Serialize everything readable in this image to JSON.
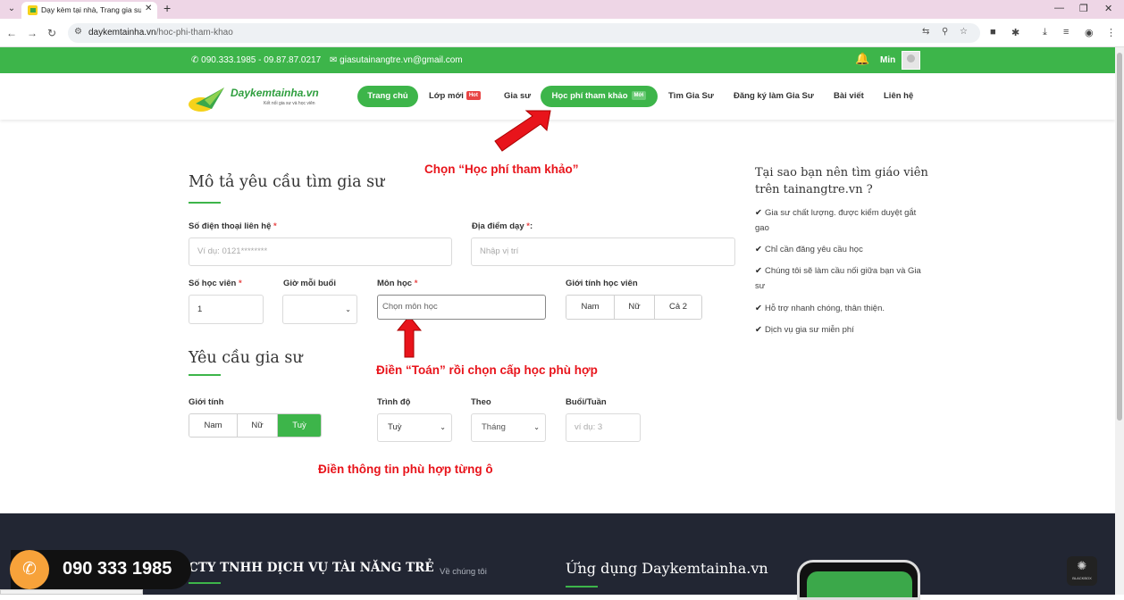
{
  "browser": {
    "tab_title": "Dạy kèm tại nhà, Trang gia sư tài năng trẻ",
    "url_domain": "daykemtainha.vn",
    "url_path": "/hoc-phi-tham-khao"
  },
  "topbar": {
    "phone": "090.333.1985 - 09.87.87.0217",
    "email": "giasutainangtre.vn@gmail.com",
    "user": "Min"
  },
  "logo": {
    "name": "Daykemtainha.vn",
    "tagline": "Kết nối gia sư và học viên"
  },
  "nav": {
    "home": "Trang chủ",
    "new_classes": "Lớp mới",
    "hot_badge": "Hot",
    "tutors": "Gia sư",
    "tuition": "Học phí tham khảo",
    "new_badge": "Mới",
    "find_tutor": "Tìm Gia Sư",
    "register_tutor": "Đăng ký làm Gia Sư",
    "posts": "Bài viết",
    "contact": "Liên hệ"
  },
  "annotations": {
    "choose_tuition": "Chọn “Học phí tham khảo”",
    "fill_math": "Điền “Toán” rồi chọn cấp học phù hợp",
    "fill_info": "Điền thông tin phù hợp từng ô"
  },
  "form": {
    "section1_title": "Mô tả yêu cầu tìm gia sư",
    "phone_label": "Số điện thoại liên hệ",
    "phone_placeholder": "Ví dụ: 0121********",
    "location_label": "Địa điểm dạy",
    "location_suffix": ":",
    "location_placeholder": "Nhập vị trí",
    "students_label": "Số học viên",
    "students_value": "1",
    "hours_label": "Giờ mỗi buổi",
    "subject_label": "Môn học",
    "subject_placeholder": "Chọn môn học",
    "gender_student_label": "Giới tính học viên",
    "gender_student_options": [
      "Nam",
      "Nữ",
      "Cả 2"
    ],
    "required_mark": "*",
    "section2_title": "Yêu cầu gia sư",
    "tutor_gender_label": "Giới tính",
    "tutor_gender_options": [
      "Nam",
      "Nữ",
      "Tuỳ"
    ],
    "tutor_gender_selected": "Tuỳ",
    "level_label": "Trình độ",
    "level_value": "Tuỳ",
    "by_label": "Theo",
    "by_value": "Tháng",
    "sessions_label": "Buổi/Tuần",
    "sessions_placeholder": "ví dụ: 3"
  },
  "sidebar": {
    "title": "Tại sao bạn nên tìm giáo viên trên tainangtre.vn ?",
    "items": [
      "Gia sư chất lượng. được kiểm duyệt gắt gao",
      "Chỉ cần đăng yêu cầu học",
      "Chúng tôi sẽ làm cầu nối giữa bạn và Gia sư",
      "Hỗ trợ nhanh chóng, thân thiện.",
      "Dịch vụ gia sư miễn phí"
    ]
  },
  "footer": {
    "company": "CTY TNHH DỊCH VỤ TÀI NĂNG TRẺ",
    "about": "Về chúng tôi",
    "app_title": "Ứng dụng Daykemtainha.vn",
    "hotline": "090 333 1985",
    "widget_label": "BLACKBOX"
  },
  "colors": {
    "brand_green": "#3db54a",
    "hot_red": "#e84444",
    "annotation_red": "#e8141b",
    "footer_bg": "#222633",
    "hotline_orange": "#f7a23a"
  },
  "icons": [
    "phone-icon",
    "mail-icon",
    "bell-icon",
    "check-icon",
    "arrow-annotation-icon",
    "select-chevron-icon"
  ]
}
